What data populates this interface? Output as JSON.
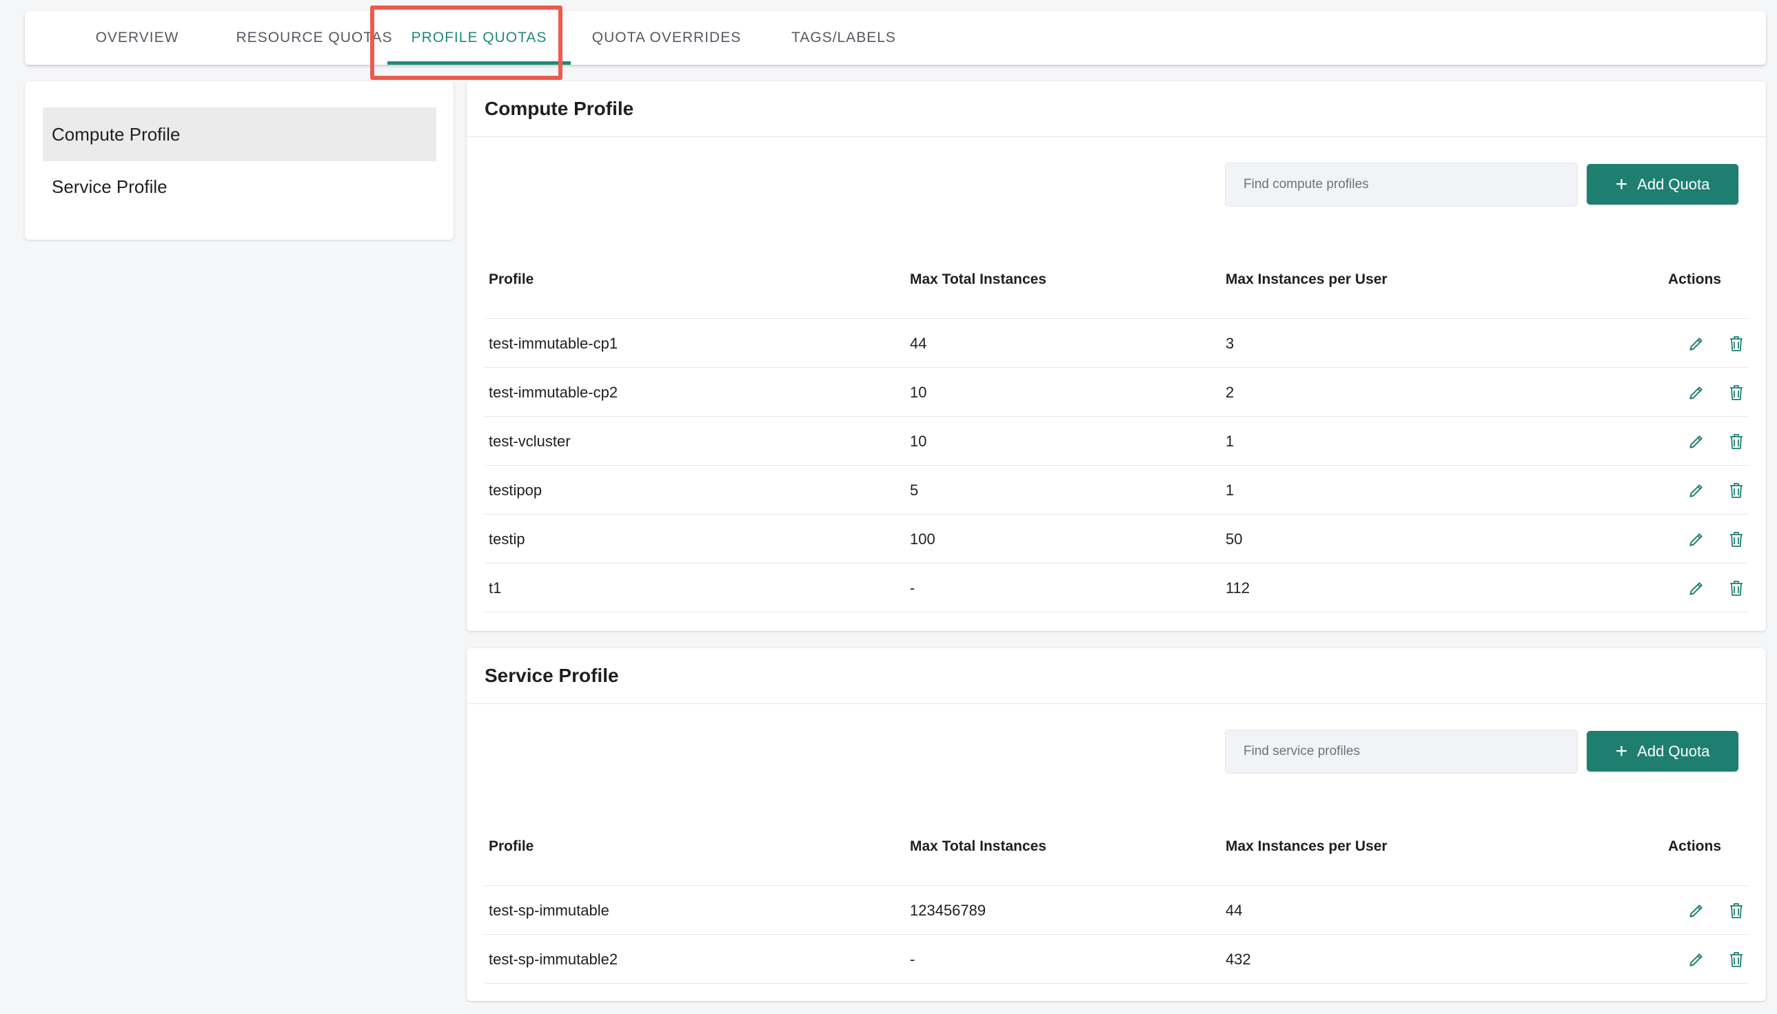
{
  "tabs": [
    {
      "label": "OVERVIEW",
      "active": false
    },
    {
      "label": "RESOURCE QUOTAS",
      "active": false
    },
    {
      "label": "PROFILE QUOTAS",
      "active": true
    },
    {
      "label": "QUOTA OVERRIDES",
      "active": false
    },
    {
      "label": "TAGS/LABELS",
      "active": false
    }
  ],
  "sidebar": {
    "items": [
      {
        "label": "Compute Profile",
        "active": true
      },
      {
        "label": "Service Profile",
        "active": false
      }
    ]
  },
  "compute": {
    "title": "Compute Profile",
    "search_placeholder": "Find compute profiles",
    "add_label": "Add Quota",
    "columns": [
      "Profile",
      "Max Total Instances",
      "Max Instances per User",
      "Actions"
    ],
    "rows": [
      {
        "profile": "test-immutable-cp1",
        "max_total": "44",
        "max_per_user": "3"
      },
      {
        "profile": "test-immutable-cp2",
        "max_total": "10",
        "max_per_user": "2"
      },
      {
        "profile": "test-vcluster",
        "max_total": "10",
        "max_per_user": "1"
      },
      {
        "profile": "testipop",
        "max_total": "5",
        "max_per_user": "1"
      },
      {
        "profile": "testip",
        "max_total": "100",
        "max_per_user": "50"
      },
      {
        "profile": "t1",
        "max_total": "-",
        "max_per_user": "112"
      }
    ]
  },
  "service": {
    "title": "Service Profile",
    "search_placeholder": "Find service profiles",
    "add_label": "Add Quota",
    "columns": [
      "Profile",
      "Max Total Instances",
      "Max Instances per User",
      "Actions"
    ],
    "rows": [
      {
        "profile": "test-sp-immutable",
        "max_total": "123456789",
        "max_per_user": "44"
      },
      {
        "profile": "test-sp-immutable2",
        "max_total": "-",
        "max_per_user": "432"
      }
    ]
  },
  "colors": {
    "accent": "#1e8a7a",
    "button": "#1e7f71",
    "highlight": "#ec5b4f"
  },
  "icons": {
    "edit": "pencil-icon",
    "delete": "trash-icon",
    "add": "plus-icon"
  }
}
